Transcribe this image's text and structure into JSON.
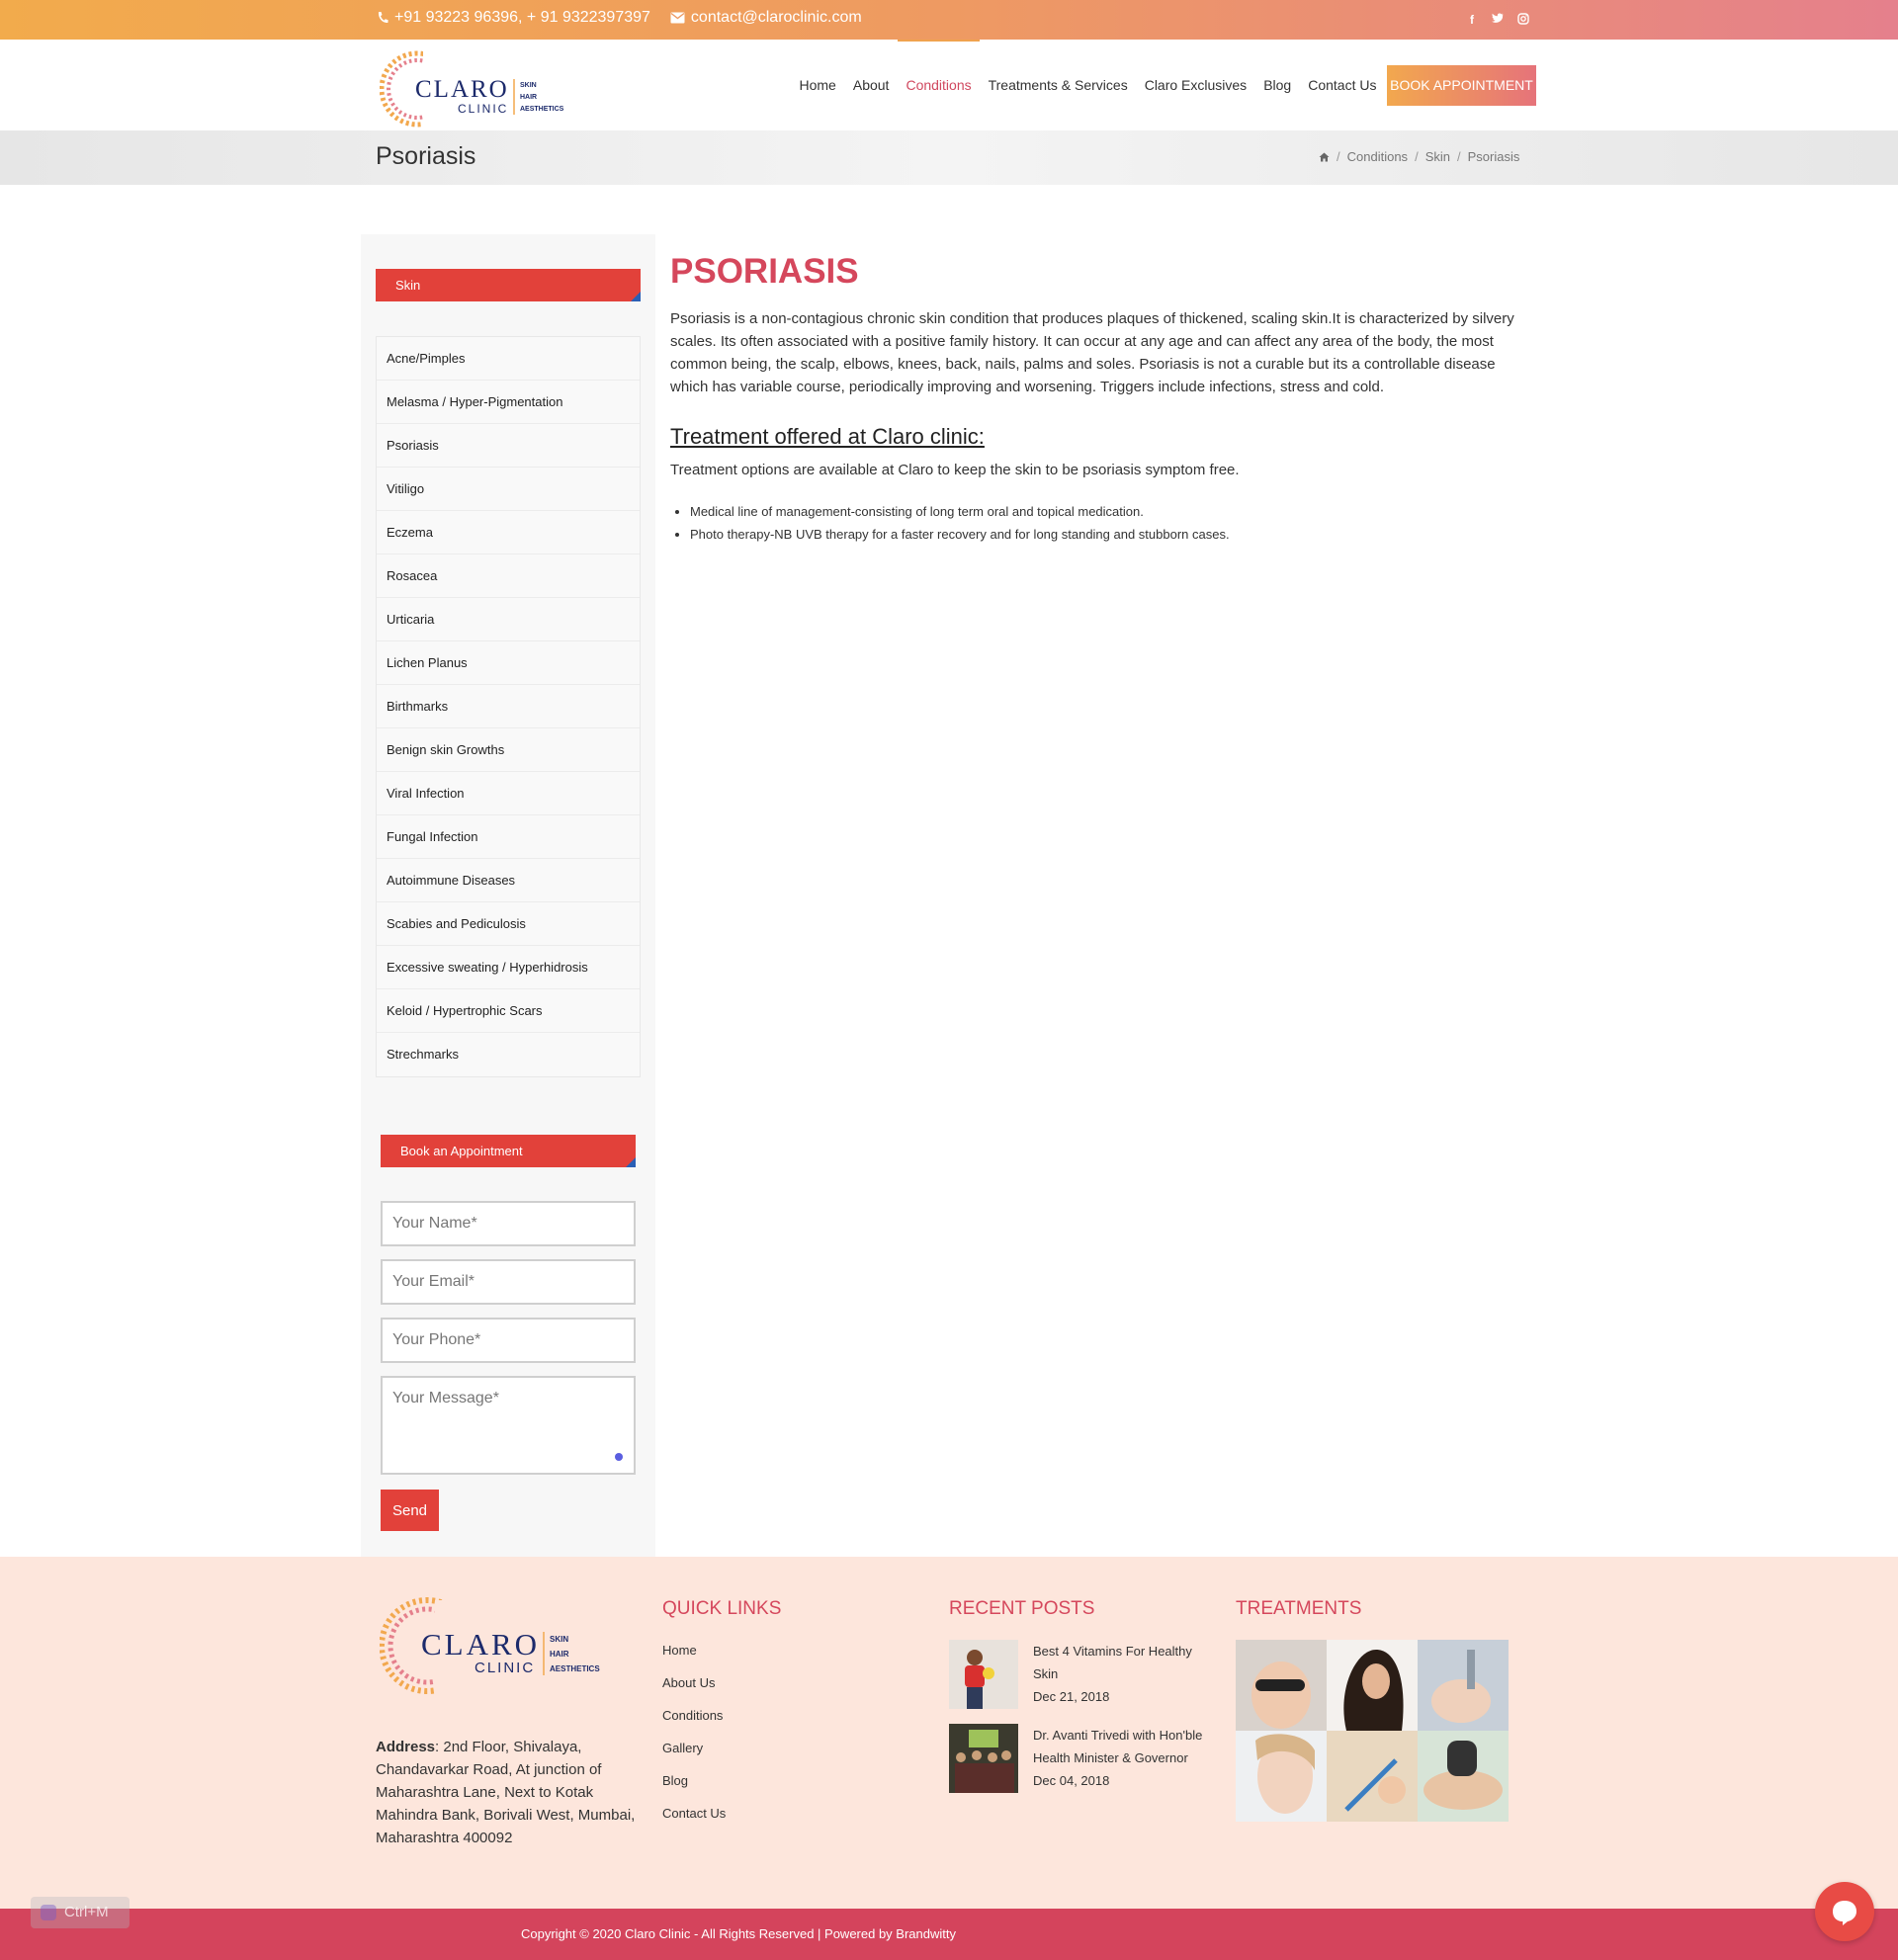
{
  "topbar": {
    "phone": "+91 93223 96396, + 91 9322397397",
    "email": "contact@claroclinic.com",
    "social": [
      "facebook-icon",
      "twitter-icon",
      "instagram-icon"
    ]
  },
  "logo": {
    "brand": "CLARO",
    "sub": "CLINIC",
    "tag1": "SKIN",
    "tag2": "HAIR",
    "tag3": "AESTHETICS"
  },
  "nav": {
    "items": [
      "Home",
      "About",
      "Conditions",
      "Treatments & Services",
      "Claro Exclusives",
      "Blog",
      "Contact Us"
    ],
    "active": "Conditions",
    "cta": "BOOK APPOINTMENT"
  },
  "page": {
    "title": "Psoriasis",
    "breadcrumb": [
      "Conditions",
      "Skin",
      "Psoriasis"
    ]
  },
  "sidebar": {
    "heading": "Skin",
    "items": [
      "Acne/Pimples",
      "Melasma / Hyper-Pigmentation",
      "Psoriasis",
      "Vitiligo",
      "Eczema",
      "Rosacea",
      "Urticaria",
      "Lichen Planus",
      "Birthmarks",
      "Benign skin Growths",
      "Viral Infection",
      "Fungal Infection",
      "Autoimmune Diseases",
      "Scabies and Pediculosis",
      "Excessive sweating / Hyperhidrosis",
      "Keloid / Hypertrophic Scars",
      "Strechmarks"
    ],
    "form_heading": "Book an Appointment",
    "form": {
      "name_placeholder": "Your Name*",
      "email_placeholder": "Your Email*",
      "phone_placeholder": "Your Phone*",
      "message_placeholder": "Your Message*",
      "send": "Send"
    }
  },
  "main": {
    "heading": "PSORIASIS",
    "body": "Psoriasis is a non-contagious chronic skin condition that produces plaques of thickened, scaling skin.It is characterized by silvery scales. Its often associated with a positive family history. It can occur at any age and can affect any area of the body, the most common being, the scalp, elbows, knees, back, nails, palms and soles. Psoriasis is not a curable but its a controllable disease which has variable course, periodically improving and worsening. Triggers include infections, stress and cold.",
    "treatment_heading": "Treatment offered at Claro clinic:",
    "treatment_intro": "Treatment options are available at Claro to keep the skin to be psoriasis symptom free.",
    "treatments": [
      "Medical line of management-consisting of long term oral and topical medication.",
      "Photo therapy-NB UVB therapy for a faster recovery and for long standing and stubborn cases."
    ]
  },
  "footer": {
    "address_label": "Address",
    "address": ": 2nd Floor, Shivalaya, Chandavarkar Road, At junction of Maharashtra Lane, Next to Kotak Mahindra Bank, Borivali West, Mumbai, Maharashtra 400092",
    "quick_links_title": "QUICK LINKS",
    "quick_links": [
      "Home",
      "About Us",
      "Conditions",
      "Gallery",
      "Blog",
      "Contact Us"
    ],
    "recent_title": "RECENT POSTS",
    "posts": [
      {
        "title": "Best 4 Vitamins For Healthy Skin",
        "date": "Dec 21, 2018"
      },
      {
        "title": "Dr. Avanti Trivedi with Hon'ble Health Minister & Governor",
        "date": "Dec 04, 2018"
      }
    ],
    "treatments_title": "TREATMENTS",
    "copyright": "Copyright © 2020 Claro Clinic - All Rights Reserved | Powered by Brandwitty"
  },
  "overlay": {
    "shortcut": "Ctrl+M"
  },
  "colors": {
    "accent": "#d5475c",
    "sidebar_head": "#e2413a",
    "footer_bg": "#fde6dc"
  }
}
